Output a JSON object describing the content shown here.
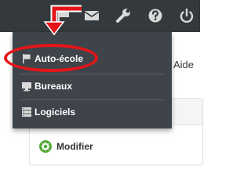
{
  "header": {
    "icons": [
      {
        "name": "flag-icon"
      },
      {
        "name": "envelope-icon"
      },
      {
        "name": "wrench-icon"
      },
      {
        "name": "help-icon"
      },
      {
        "name": "power-icon"
      }
    ]
  },
  "dropdown": {
    "items": [
      {
        "label": "Auto-école",
        "icon": "flag-icon"
      },
      {
        "label": "Bureaux",
        "icon": "monitor-icon"
      },
      {
        "label": "Logiciels",
        "icon": "server-icon"
      }
    ]
  },
  "background": {
    "aide_label": "Aide",
    "modifier_label": "Modifier"
  },
  "annotation": {
    "color": "#e3151a",
    "arrow": "red-arrow",
    "highlight": "red-oval"
  },
  "colors": {
    "topbar": "#34393d",
    "dropdown": "#3f444a",
    "modifier_icon": "#59a83a"
  }
}
